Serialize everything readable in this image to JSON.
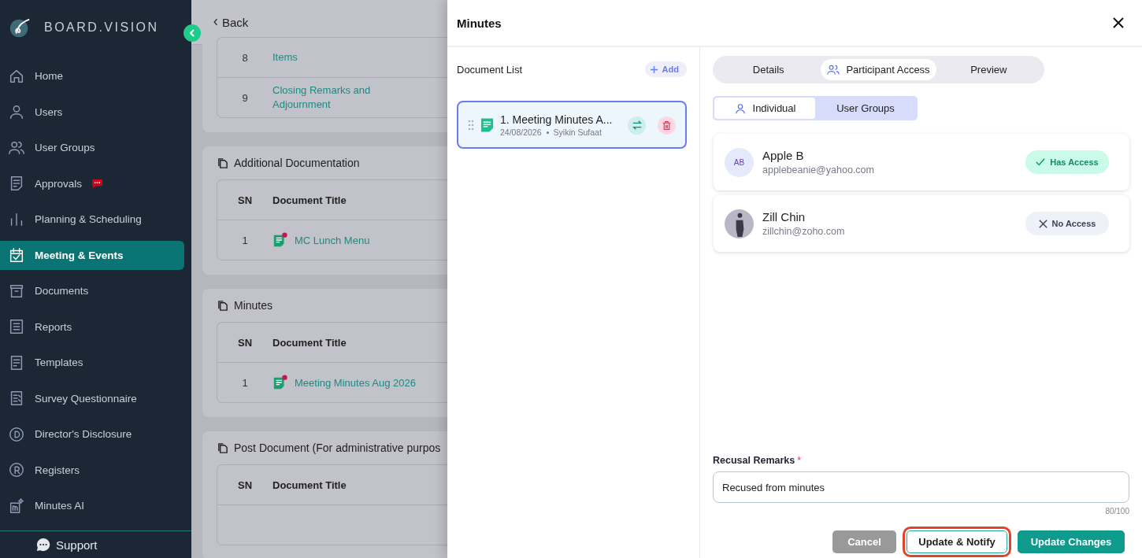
{
  "sidebar": {
    "brand": "BOARD.VISION",
    "items": [
      {
        "label": "Home",
        "selected": false,
        "badge": false
      },
      {
        "label": "Users",
        "selected": false,
        "badge": false
      },
      {
        "label": "User Groups",
        "selected": false,
        "badge": false
      },
      {
        "label": "Approvals",
        "selected": false,
        "badge": true
      },
      {
        "label": "Planning & Scheduling",
        "selected": false,
        "badge": false
      },
      {
        "label": "Meeting & Events",
        "selected": true,
        "badge": false
      },
      {
        "label": "Documents",
        "selected": false,
        "badge": false
      },
      {
        "label": "Reports",
        "selected": false,
        "badge": false
      },
      {
        "label": "Templates",
        "selected": false,
        "badge": false
      },
      {
        "label": "Survey Questionnaire",
        "selected": false,
        "badge": false
      },
      {
        "label": "Director's Disclosure",
        "selected": false,
        "badge": false
      },
      {
        "label": "Registers",
        "selected": false,
        "badge": false
      },
      {
        "label": "Minutes AI",
        "selected": false,
        "badge": false
      }
    ],
    "support": "Support"
  },
  "page": {
    "back": "Back",
    "agenda_rows": [
      {
        "sn": "8",
        "title": "Items"
      },
      {
        "sn": "9",
        "title": "Closing Remarks and Adjournment"
      }
    ],
    "sections": [
      {
        "title": "Additional Documentation",
        "columns": [
          "SN",
          "Document Title"
        ],
        "rows": [
          {
            "sn": "1",
            "title": "MC Lunch Menu"
          }
        ]
      },
      {
        "title": "Minutes",
        "columns": [
          "SN",
          "Document Title"
        ],
        "rows": [
          {
            "sn": "1",
            "title": "Meeting Minutes Aug 2026"
          }
        ]
      },
      {
        "title": "Post Document (For administrative purpos",
        "columns": [
          "SN",
          "Document Title"
        ]
      }
    ]
  },
  "drawer": {
    "title": "Minutes",
    "document_list": {
      "title": "Document List",
      "add": "Add",
      "items": [
        {
          "title": "1. Meeting Minutes A...",
          "date": "24/08/2026",
          "author": "Syikin Sufaat",
          "selected": true
        }
      ]
    },
    "tabs": [
      {
        "label": "Details",
        "selected": false
      },
      {
        "label": "Participant Access",
        "selected": true
      },
      {
        "label": "Preview",
        "selected": false
      }
    ],
    "subtabs": [
      {
        "label": "Individual",
        "selected": true
      },
      {
        "label": "User Groups",
        "selected": false
      }
    ],
    "participants": [
      {
        "name": "Apple B",
        "email": "applebeanie@yahoo.com",
        "initials": "AB",
        "has_access": true,
        "access_label": "Has Access"
      },
      {
        "name": "Zill Chin",
        "email": "zillchin@zoho.com",
        "has_access": false,
        "access_label": "No Access"
      }
    ],
    "remarks": {
      "label": "Recusal Remarks",
      "required_mark": "*",
      "value": "Recused from minutes",
      "counter": "80/100"
    },
    "buttons": [
      {
        "label": "Cancel",
        "kind": "muted",
        "highlighted": false
      },
      {
        "label": "Update & Notify",
        "kind": "outline",
        "highlighted": true
      },
      {
        "label": "Update Changes",
        "kind": "primary",
        "highlighted": false
      }
    ]
  }
}
